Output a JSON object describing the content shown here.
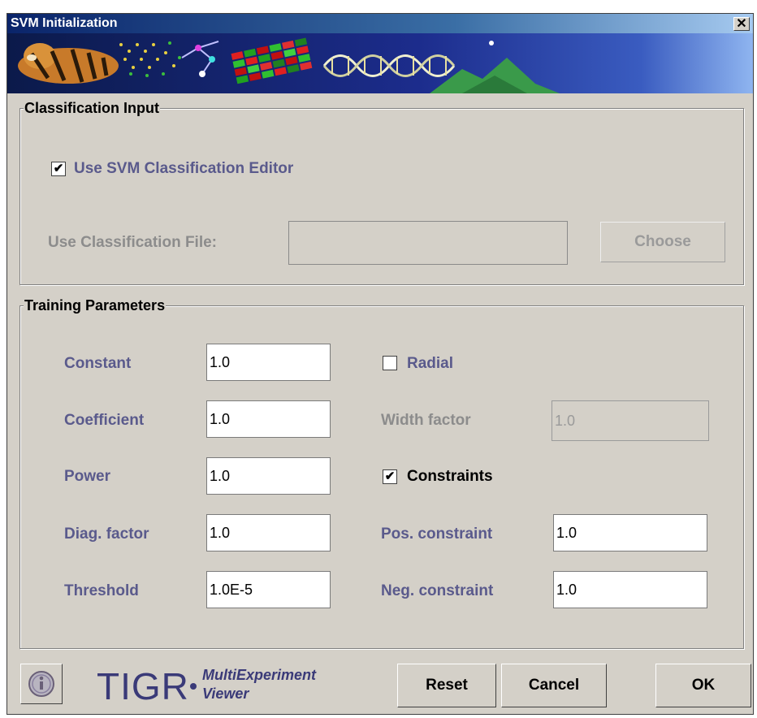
{
  "window": {
    "title": "SVM Initialization",
    "close_glyph": "✕"
  },
  "classification_input": {
    "title": "Classification Input",
    "use_editor_label": "Use SVM Classification Editor",
    "use_editor_checked": true,
    "file_label": "Use Classification File:",
    "file_value": "",
    "choose_label": "Choose"
  },
  "training": {
    "title": "Training Parameters",
    "constant": {
      "label": "Constant",
      "value": "1.0"
    },
    "coefficient": {
      "label": "Coefficient",
      "value": "1.0"
    },
    "power": {
      "label": "Power",
      "value": "1.0"
    },
    "diag_factor": {
      "label": "Diag. factor",
      "value": "1.0"
    },
    "threshold": {
      "label": "Threshold",
      "value": "1.0E-5"
    },
    "radial": {
      "label": "Radial",
      "checked": false
    },
    "width_factor": {
      "label": "Width factor",
      "value": "1.0"
    },
    "constraints": {
      "label": "Constraints",
      "checked": true
    },
    "pos_constraint": {
      "label": "Pos. constraint",
      "value": "1.0"
    },
    "neg_constraint": {
      "label": "Neg. constraint",
      "value": "1.0"
    }
  },
  "footer": {
    "logo_text": "TIGR",
    "logo_sub_line1": "MultiExperiment",
    "logo_sub_line2": "Viewer",
    "reset_label": "Reset",
    "cancel_label": "Cancel",
    "ok_label": "OK",
    "info_icon": "info-icon"
  },
  "check_glyph": "✔"
}
